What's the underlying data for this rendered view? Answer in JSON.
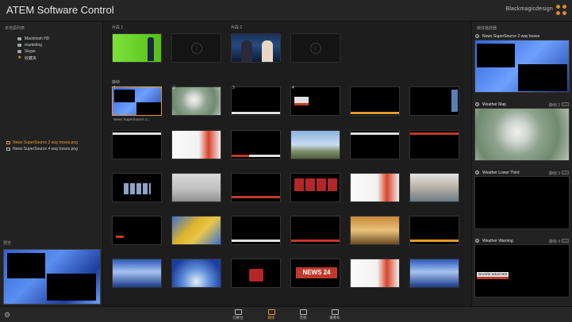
{
  "app": {
    "title": "ATEM Software Control",
    "brand": "Blackmagicdesign"
  },
  "sidebar": {
    "header": "本地源列表",
    "tree": [
      {
        "label": "Macintosh HD",
        "icon": "disk-icon"
      },
      {
        "label": "marketing",
        "icon": "folder-icon"
      },
      {
        "label": "Skype",
        "icon": "folder-icon"
      },
      {
        "label": "收藏夹",
        "icon": "star-icon"
      }
    ],
    "files": [
      {
        "label": "News SuperSource 2 way boxes.png",
        "selected": true
      },
      {
        "label": "News SuperSource 4 way boxes.png",
        "selected": false
      }
    ],
    "preview_header": "预览"
  },
  "main": {
    "clips_header_1": "片段 1",
    "clips_header_2": "片段 2",
    "stills_header": "静帧",
    "slot_numbers": [
      "1",
      "2",
      "3",
      "4"
    ],
    "first_caption": "News SuperSource 2..."
  },
  "rightpane": {
    "header": "媒体播放器",
    "items": [
      {
        "index": "1",
        "name": "News SuperSource 2 way boxes",
        "sub": ""
      },
      {
        "index": "2",
        "name": "Weather Map",
        "sub": "静帧 2"
      },
      {
        "index": "3",
        "name": "Weather Lower Third",
        "sub": "静帧 3"
      },
      {
        "index": "4",
        "name": "Weather Warning",
        "sub": "静帧 4"
      }
    ]
  },
  "bottom": {
    "nav": [
      {
        "label": "切换台",
        "icon": "switcher-icon",
        "selected": false
      },
      {
        "label": "媒体",
        "icon": "media-icon",
        "selected": true
      },
      {
        "label": "音频",
        "icon": "audio-icon",
        "selected": false
      },
      {
        "label": "摄像机",
        "icon": "camera-icon",
        "selected": false
      }
    ]
  },
  "thumbnails": {
    "news24": "NEWS 24",
    "weather_warning": "SEVERE WEATHER"
  },
  "colors": {
    "accent": "#e89a2c",
    "background": "#1e1e1e"
  }
}
